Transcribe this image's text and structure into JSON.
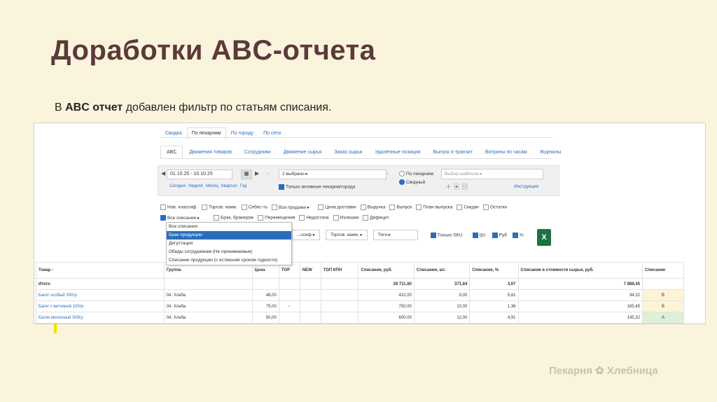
{
  "slide": {
    "title": "Доработки ABC-отчета",
    "subtitle_prefix": "В ",
    "subtitle_bold": "ABC отчет",
    "subtitle_rest": " добавлен фильтр по статьям списания.",
    "logo_text": "Пекарня ✿ Хлебница"
  },
  "top_tabs": [
    "Сводка",
    "По пекарням",
    "По городу",
    "По сети"
  ],
  "sub_tabs": [
    "ABC",
    "Движения товаров",
    "Сотрудники",
    "Движение сырья",
    "Заказ сырья",
    "Удалённые позиции",
    "Выпуск и транзит",
    "Витрины по часам",
    "Журналы"
  ],
  "filters": {
    "date_range": "01.10.25 - 10.10.25",
    "quick_ranges": [
      "Сегодня",
      "Неделя",
      "Месяц",
      "Квартал",
      "Год"
    ],
    "bakeries_select": "2 выбрано ▸",
    "only_active": "Только активные пекарни/города",
    "radio_by_bakery": "По пекарням",
    "radio_summary": "Сводный",
    "template_placeholder": "Выбор шаблона ▸",
    "instructions": "Инструкция"
  },
  "checks_row1": [
    "Нов. классиф.",
    "Торгов. наим.",
    "Себес-ть",
    "Все продажи ▸",
    "Цена доставки",
    "Выручка",
    "Выпуск",
    "План выпуска",
    "Скидки",
    "Остатки"
  ],
  "checks_row2": [
    "Все списания ▸",
    "Брак, бракераж",
    "Перемещения",
    "Недостача",
    "Излишки",
    "Дефицит"
  ],
  "row3": {
    "classif": "...ссиф ▸",
    "trade_name": "Торгов. наим. ▸",
    "tags": "Теги ▸",
    "only_sku": "Только SKU",
    "pcs": "Шт.",
    "rub": "Руб",
    "percent": "%"
  },
  "dropdown_items": [
    "Все списания",
    "Брак продукции",
    "Дегустация",
    "Обеды сотрудникам (Не принимаемые)",
    "Списание продукции (с истекшим сроком годности)"
  ],
  "table": {
    "headers": [
      "Товар ↑",
      "Группа",
      "Цена",
      "TOP",
      "NEW",
      "ТОП КПН",
      "Списания, руб.",
      "Списания, шт.",
      "Списания, %",
      "Списания в стоимости сырья, руб.",
      "Списание"
    ],
    "total": [
      "Итого",
      "",
      "",
      "",
      "",
      "",
      "29 711,60",
      "371,84",
      "3,07",
      "7 888,45",
      ""
    ],
    "rows": [
      [
        "Багет особый 300гр",
        "04. Хлеба",
        "48,00",
        "",
        "",
        "",
        "432,00",
        "9,00",
        "5,61",
        "94,32",
        "B"
      ],
      [
        "Багет с ветчиной 100гр",
        "04. Хлеба",
        "75,00",
        "✓",
        "",
        "",
        "750,00",
        "10,00",
        "1,36",
        "185,45",
        "B"
      ],
      [
        "Батон молочный 300гр",
        "04. Хлеба",
        "50,00",
        "",
        "",
        "",
        "600,00",
        "12,00",
        "4,91",
        "145,32",
        "A"
      ]
    ]
  },
  "colors": {
    "accent": "#2a6ebb",
    "title": "#5a3a3a",
    "background": "#fbf4dc",
    "excel": "#1e7145"
  },
  "icons": [
    "calendar-icon",
    "excel-icon",
    "add-icon",
    "save-icon",
    "delete-icon"
  ]
}
